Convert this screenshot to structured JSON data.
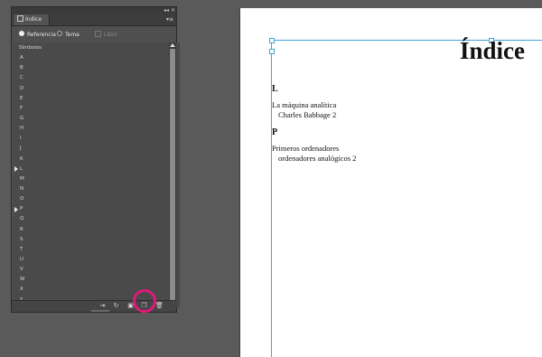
{
  "panel": {
    "tab_title": "Índice",
    "collapse_glyph": "◂◂",
    "close_glyph": "✕",
    "menu_glyph": "▾≡",
    "radios": {
      "referencia": "Referencia",
      "tema": "Tema",
      "libro": "Libro"
    },
    "list": {
      "symbols_label": "Símbolos",
      "letters": [
        "A",
        "B",
        "C",
        "D",
        "E",
        "F",
        "G",
        "H",
        "I",
        "J",
        "K",
        "L",
        "M",
        "N",
        "O",
        "P",
        "Q",
        "R",
        "S",
        "T",
        "U",
        "V",
        "W",
        "X",
        "Y"
      ],
      "expanded_letters": [
        "L",
        "P"
      ]
    },
    "footer_icons": [
      "go-to-selected-icon",
      "refresh-icon",
      "create-index-icon",
      "new-entry-icon",
      "delete-icon"
    ],
    "highlight_color": "#e0197a"
  },
  "document": {
    "title": "Índice",
    "sections": [
      {
        "letter": "L",
        "entries": [
          {
            "topic": "La máquina analítica",
            "sub": "Charles Babbage  2"
          }
        ]
      },
      {
        "letter": "P",
        "entries": [
          {
            "topic": "Primeros ordenadores",
            "sub": "ordenadores analógicos  2"
          }
        ]
      }
    ],
    "frame_color": "#3fa3d8"
  }
}
